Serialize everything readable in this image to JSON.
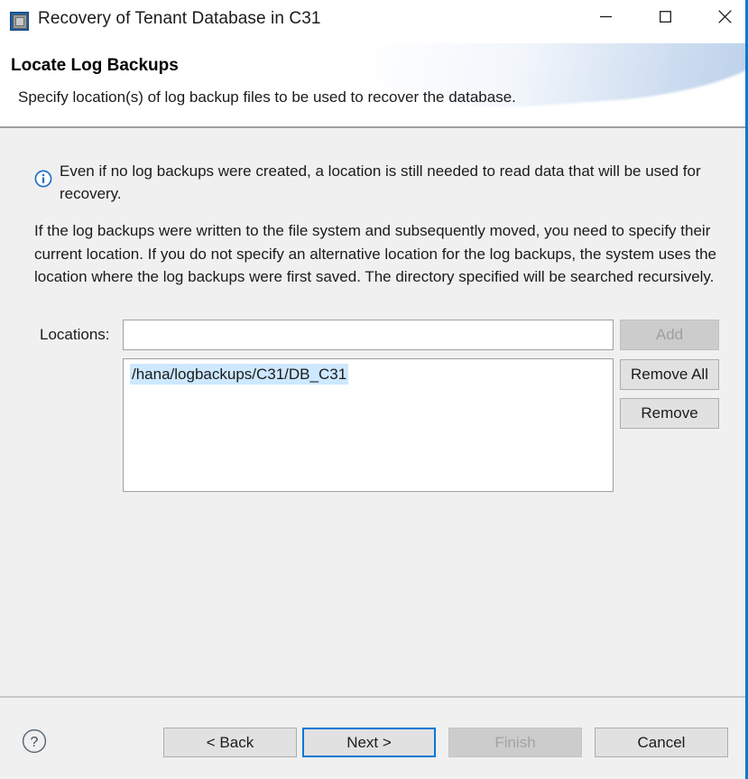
{
  "window": {
    "title": "Recovery of Tenant Database in C31",
    "icon": "application-window-icon",
    "controls": {
      "minimize": {
        "name": "minimize-button",
        "glyph": "minimize-icon"
      },
      "maximize": {
        "name": "maximize-button",
        "glyph": "maximize-icon"
      },
      "close": {
        "name": "close-button",
        "glyph": "close-icon"
      }
    }
  },
  "header": {
    "title": "Locate Log Backups",
    "description": "Specify location(s) of log backup files to be used to recover the database."
  },
  "body": {
    "info": {
      "icon": "info-circle-icon",
      "text": "Even if no log backups were created, a location is still needed to read data that will be used for recovery."
    },
    "paragraph": "If the log backups were written to the file system and subsequently moved, you need to specify their current location. If you do not specify an alternative location for the log backups, the system uses the location where the log backups were first saved. The directory specified will be searched recursively.",
    "locations": {
      "label": "Locations:",
      "input_value": "",
      "input_placeholder": "",
      "items": [
        {
          "path": "/hana/logbackups/C31/DB_C31",
          "selected": true
        }
      ],
      "buttons": {
        "add": {
          "label": "Add",
          "enabled": false
        },
        "remove_all": {
          "label": "Remove All",
          "enabled": true
        },
        "remove": {
          "label": "Remove",
          "enabled": true
        }
      }
    }
  },
  "footer": {
    "help": {
      "icon": "help-circle-icon",
      "label": "?"
    },
    "buttons": {
      "back": {
        "label": "< Back",
        "enabled": true,
        "focused": false
      },
      "next": {
        "label": "Next >",
        "enabled": true,
        "focused": true
      },
      "finish": {
        "label": "Finish",
        "enabled": false,
        "focused": false
      },
      "cancel": {
        "label": "Cancel",
        "enabled": true,
        "focused": false
      }
    }
  },
  "colors": {
    "accent": "#0078d7",
    "window_border": "#0b78d0",
    "dialog_bg": "#f0f0f0",
    "header_bg": "#ffffff",
    "selection_bg": "#cde8ff",
    "info_blue": "#1f6fc4",
    "disabled_text": "#a0a0a0"
  }
}
